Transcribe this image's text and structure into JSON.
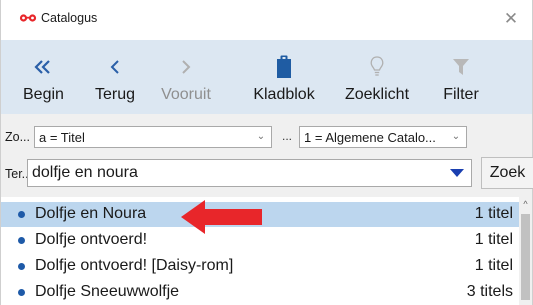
{
  "window": {
    "title": "Catalogus",
    "close_glyph": "✕",
    "title_icon": "glasses-icon"
  },
  "toolbar": {
    "items": [
      {
        "label": "Begin",
        "icon": "double-chevron-left-icon",
        "enabled": true
      },
      {
        "label": "Terug",
        "icon": "chevron-left-icon",
        "enabled": true
      },
      {
        "label": "Vooruit",
        "icon": "chevron-right-icon",
        "enabled": false
      },
      {
        "label": "Kladblok",
        "icon": "clipboard-icon",
        "enabled": true
      },
      {
        "label": "Zoeklicht",
        "icon": "lightbulb-icon",
        "enabled": true
      },
      {
        "label": "Filter",
        "icon": "funnel-icon",
        "enabled": true
      }
    ]
  },
  "search_options": {
    "field_label": "Zo...",
    "field_value": "a = Titel",
    "dots_label": "...",
    "catalog_value": "1 = Algemene Catalo...",
    "dropdown_glyph": "⌄"
  },
  "search": {
    "label": "Ter...",
    "value": "dolfje en noura",
    "button_label": "Zoek"
  },
  "results": [
    {
      "title": "Dolfje en Noura",
      "count": "1 titel",
      "selected": true
    },
    {
      "title": "Dolfje ontvoerd!",
      "count": "1 titel",
      "selected": false
    },
    {
      "title": "Dolfje ontvoerd! [Daisy-rom]",
      "count": "1 titel",
      "selected": false
    },
    {
      "title": "Dolfje Sneeuwwolfje",
      "count": "3 titels",
      "selected": false
    }
  ],
  "scrollbar": {
    "up_glyph": "^"
  },
  "colors": {
    "toolbar_bg": "#dce7f2",
    "icon_blue": "#2a5fa8",
    "icon_gray": "#b0b0b0",
    "selection": "#bcd6ee",
    "annotation_arrow": "#e8262a",
    "bullet": "#1e5aa8"
  }
}
